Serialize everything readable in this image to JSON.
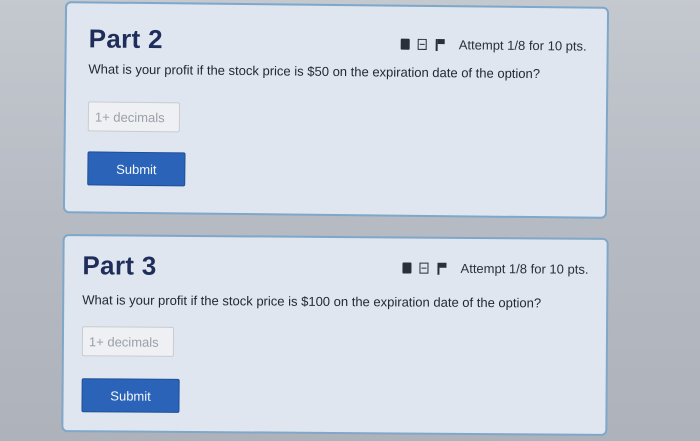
{
  "part2": {
    "title": "Part 2",
    "attempt": "Attempt 1/8 for 10 pts.",
    "question": "What is your profit if the stock price is $50 on the expiration date of the option?",
    "input_placeholder": "1+ decimals",
    "submit_label": "Submit"
  },
  "part3": {
    "title": "Part 3",
    "attempt": "Attempt 1/8 for 10 pts.",
    "question": "What is your profit if the stock price is $100 on the expiration date of the option?",
    "input_placeholder": "1+ decimals",
    "submit_label": "Submit"
  },
  "icons": [
    "book-icon",
    "notes-icon",
    "flag-icon"
  ],
  "colors": {
    "card_background": "#dfe6f0",
    "card_border": "#7fa7c9",
    "title": "#1f2d5a",
    "submit_button": "#2b63b8"
  }
}
